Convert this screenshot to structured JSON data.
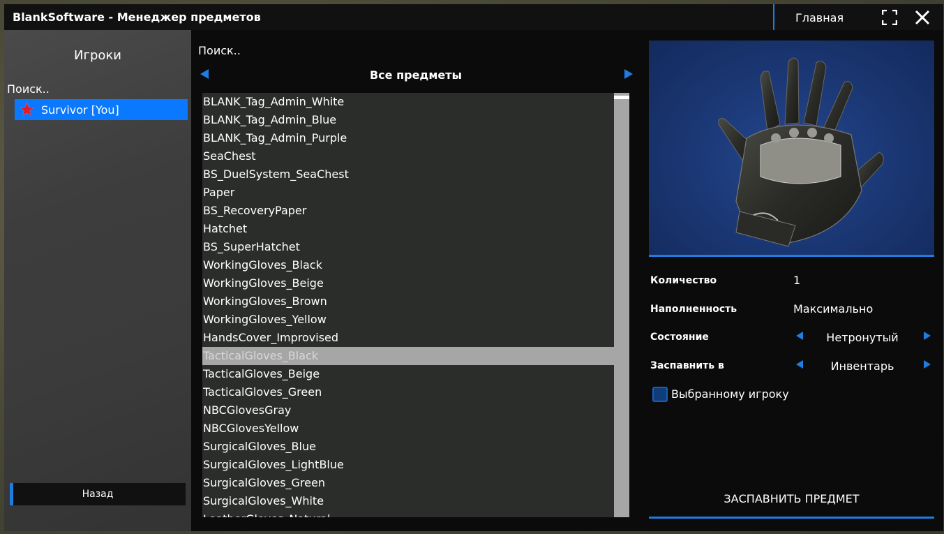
{
  "window": {
    "title": "BlankSoftware - Менеджер предметов",
    "home_label": "Главная"
  },
  "icons": {
    "fullscreen": "fullscreen-icon",
    "close": "close-icon",
    "star": "star-icon",
    "arrow_left": "arrow-left-icon",
    "arrow_right": "arrow-right-icon"
  },
  "colors": {
    "accent": "#1e7de0",
    "selected_player": "#0a79ff",
    "star": "#e01a2a"
  },
  "players": {
    "title": "Игроки",
    "search_placeholder": "Поиск..",
    "items": [
      {
        "label": "Survivor [You]"
      }
    ],
    "back_label": "Назад"
  },
  "items": {
    "search_placeholder": "Поиск..",
    "category": "Все предметы",
    "list": [
      "BLANK_Tag_Admin_White",
      "BLANK_Tag_Admin_Blue",
      "BLANK_Tag_Admin_Purple",
      "SeaChest",
      "BS_DuelSystem_SeaChest",
      "Paper",
      "BS_RecoveryPaper",
      "Hatchet",
      "BS_SuperHatchet",
      "WorkingGloves_Black",
      "WorkingGloves_Beige",
      "WorkingGloves_Brown",
      "WorkingGloves_Yellow",
      "HandsCover_Improvised",
      "TacticalGloves_Black",
      "TacticalGloves_Beige",
      "TacticalGloves_Green",
      "NBCGlovesGray",
      "NBCGlovesYellow",
      "SurgicalGloves_Blue",
      "SurgicalGloves_LightBlue",
      "SurgicalGloves_Green",
      "SurgicalGloves_White",
      "LeatherGloves_Natural"
    ],
    "selected_index": 14
  },
  "details": {
    "quantity_label": "Количество",
    "quantity_value": "1",
    "fill_label": "Наполненность",
    "fill_value": "Максимально",
    "condition_label": "Состояние",
    "condition_value": "Нетронутый",
    "spawn_in_label": "Заспавнить в",
    "spawn_in_value": "Инвентарь",
    "selected_player_label": "Выбранному игроку",
    "selected_player_checked": false,
    "spawn_button_label": "ЗАСПАВНИТЬ ПРЕДМЕТ"
  }
}
